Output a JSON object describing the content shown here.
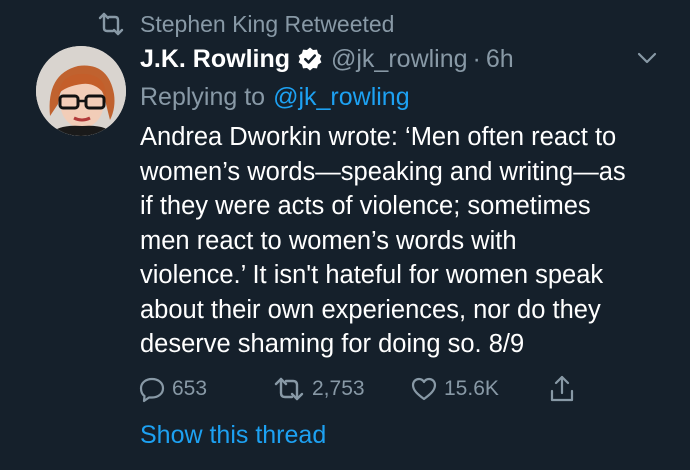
{
  "context": {
    "label": "Stephen King Retweeted",
    "icon": "retweet-icon"
  },
  "author": {
    "display_name": "J.K. Rowling",
    "verified": true,
    "handle": "@jk_rowling",
    "separator": "·",
    "time": "6h"
  },
  "replying": {
    "prefix": "Replying to",
    "mention": "@jk_rowling"
  },
  "tweet": {
    "text": "Andrea Dworkin wrote: ‘Men often react to\nwomen’s words—speaking and writing—as\nif they were acts of violence; sometimes\nmen react to women’s words with\nviolence.’ It isn't hateful for women speak\nabout their own experiences, nor do they\ndeserve shaming for doing so. 8/9"
  },
  "actions": {
    "replies": "653",
    "retweets": "2,753",
    "likes": "15.6K"
  },
  "show_thread_label": "Show this thread",
  "colors": {
    "background": "#15202b",
    "text": "#ffffff",
    "secondary": "#8899a6",
    "accent": "#1da1f2"
  }
}
